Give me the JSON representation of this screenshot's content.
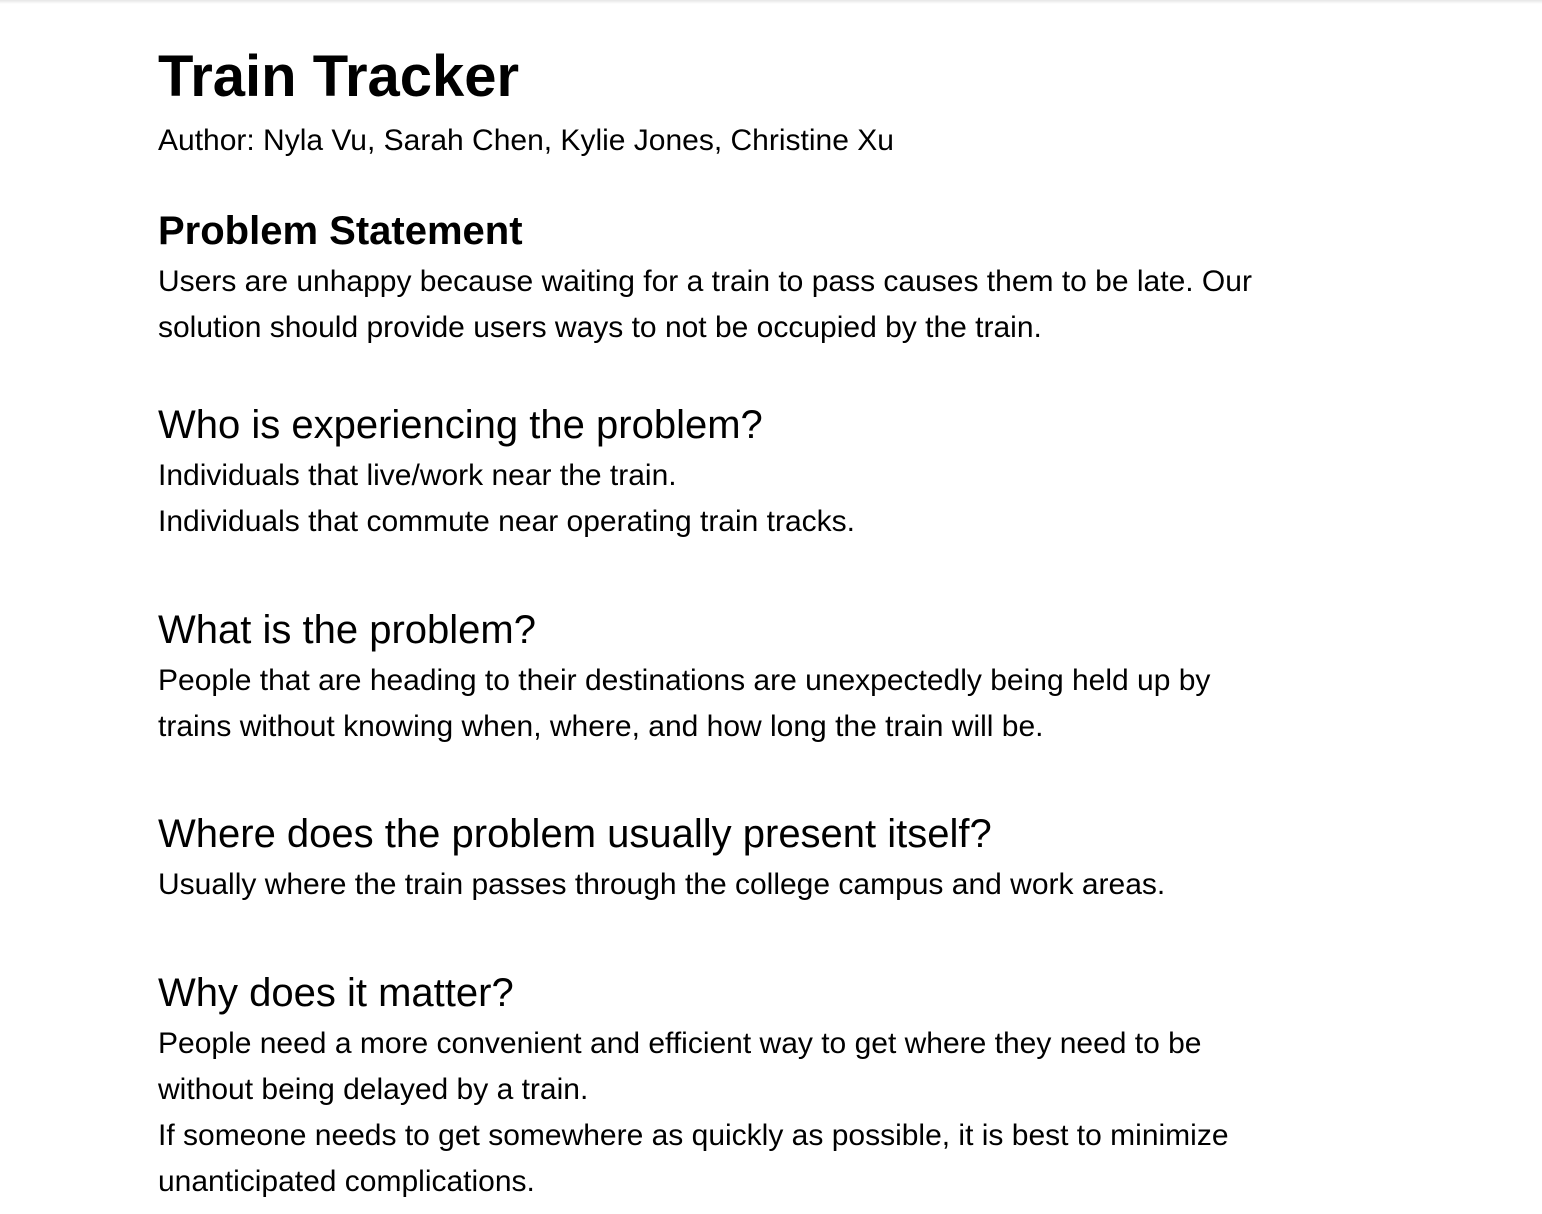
{
  "document": {
    "title": "Train Tracker",
    "author": "Author: Nyla Vu, Sarah Chen, Kylie Jones, Christine Xu"
  },
  "sections": [
    {
      "heading": "Problem Statement",
      "lines": [
        "Users are unhappy because waiting for a train to pass causes them to be late. Our",
        "solution should provide users ways to not be occupied by the train."
      ]
    },
    {
      "heading": "Who is experiencing the problem?",
      "lines": [
        "Individuals that live/work near the train.",
        "Individuals that commute near operating train tracks."
      ]
    },
    {
      "heading": "What is the problem?",
      "lines": [
        "People that are heading to their destinations are unexpectedly being held up by",
        "trains without knowing when, where, and how long the train will be."
      ]
    },
    {
      "heading": "Where does the problem usually present itself?",
      "lines": [
        "Usually where the train passes through the college campus and work areas."
      ]
    },
    {
      "heading": "Why does it matter?",
      "lines": [
        "People need a more convenient and efficient way to get where they need to be",
        "without being delayed by a train.",
        "If someone needs to get somewhere as quickly as possible, it is best to minimize",
        "unanticipated complications."
      ]
    }
  ]
}
